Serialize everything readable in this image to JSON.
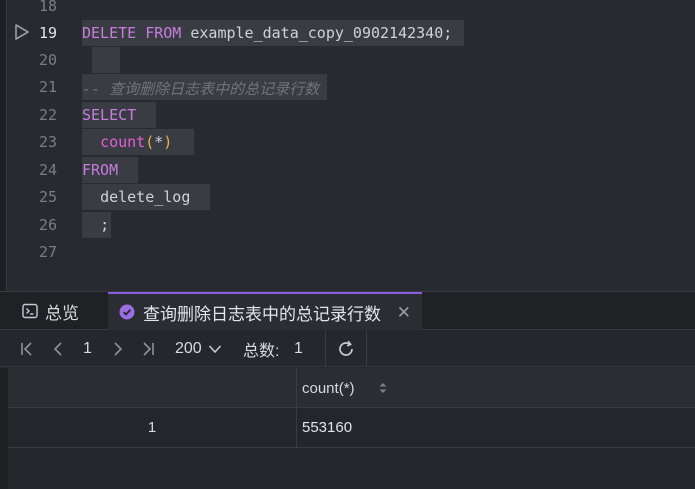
{
  "editor": {
    "lines": [
      {
        "num": "18",
        "text": ""
      },
      {
        "num": "19",
        "kw": "DELETE FROM",
        "rest": " example_data_copy_0902142340;"
      },
      {
        "num": "20",
        "text": ""
      },
      {
        "num": "21",
        "comment": "-- 查询删除日志表中的总记录行数"
      },
      {
        "num": "22",
        "kw": "SELECT"
      },
      {
        "num": "23",
        "fn": "count",
        "lp": "(",
        "arg": "*",
        "rp": ")"
      },
      {
        "num": "24",
        "kw": "FROM"
      },
      {
        "num": "25",
        "ident": "delete_log"
      },
      {
        "num": "26",
        "punct": ";"
      },
      {
        "num": "27",
        "text": ""
      }
    ]
  },
  "panel": {
    "tabs": [
      {
        "label": "总览",
        "icon": "terminal-icon"
      },
      {
        "label": "查询删除日志表中的总记录行数",
        "icon": "check-circle-icon",
        "close": "✕"
      }
    ],
    "toolbar": {
      "page": "1",
      "page_size": "200",
      "total_label": "总数:",
      "total_value": "1"
    },
    "grid": {
      "columns": [
        "count(*)"
      ],
      "rows": [
        {
          "num": "1",
          "values": [
            "553160"
          ]
        }
      ]
    }
  },
  "colors": {
    "keyword": "#c77dde",
    "function": "#e35ed8",
    "paren": "#e8b04b",
    "comment": "#6f737b",
    "accent": "#8c5ce0"
  }
}
